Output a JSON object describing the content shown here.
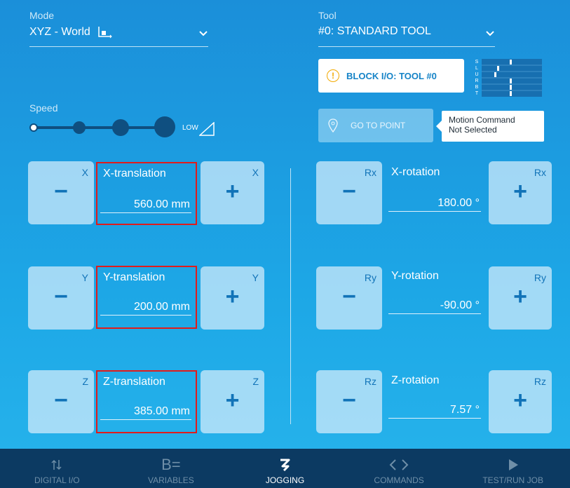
{
  "mode": {
    "label": "Mode",
    "value": "XYZ - World"
  },
  "tool": {
    "label": "Tool",
    "value": "#0: STANDARD TOOL"
  },
  "speed": {
    "label": "Speed",
    "level_text": "LOW"
  },
  "block_io": {
    "label": "BLOCK I/O: TOOL #0",
    "indicator_letters": [
      "S",
      "L",
      "U",
      "R",
      "B",
      "T"
    ]
  },
  "go_to_point": {
    "label": "GO TO POINT"
  },
  "tooltip": {
    "line1": "Motion Command",
    "line2": "Not Selected"
  },
  "translation": [
    {
      "axis": "X",
      "title": "X-translation",
      "value": "560.00 mm"
    },
    {
      "axis": "Y",
      "title": "Y-translation",
      "value": "200.00 mm"
    },
    {
      "axis": "Z",
      "title": "Z-translation",
      "value": "385.00 mm"
    }
  ],
  "rotation": [
    {
      "axis": "Rx",
      "title": "X-rotation",
      "value": "180.00 °"
    },
    {
      "axis": "Ry",
      "title": "Y-rotation",
      "value": "-90.00 °"
    },
    {
      "axis": "Rz",
      "title": "Z-rotation",
      "value": "7.57 °"
    }
  ],
  "buttons": {
    "minus": "−",
    "plus": "+"
  },
  "nav": [
    {
      "label": "DIGITAL I/O",
      "icon": "arrows-updown-icon"
    },
    {
      "label": "VARIABLES",
      "icon": "variables-icon",
      "glyph": "B="
    },
    {
      "label": "JOGGING",
      "icon": "jogging-icon",
      "active": true
    },
    {
      "label": "COMMANDS",
      "icon": "code-brackets-icon"
    },
    {
      "label": "TEST/RUN JOB",
      "icon": "play-icon"
    }
  ],
  "colors": {
    "accent": "#1583c7",
    "nav_bg": "#0c3a62",
    "highlight": "#e11b1b"
  }
}
